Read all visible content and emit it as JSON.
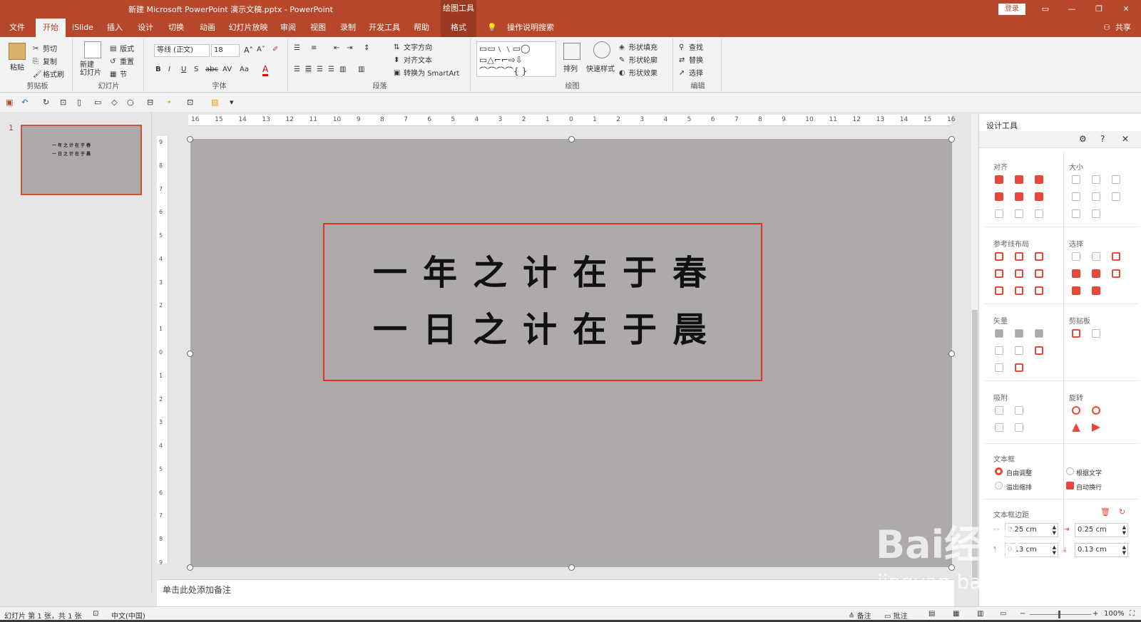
{
  "titlebar": {
    "title": "新建 Microsoft PowerPoint 演示文稿.pptx  -  PowerPoint",
    "contextual": "绘图工具",
    "login": "登录"
  },
  "tabs": [
    "文件",
    "开始",
    "iSlide",
    "插入",
    "设计",
    "切换",
    "动画",
    "幻灯片放映",
    "审阅",
    "视图",
    "录制",
    "开发工具",
    "帮助",
    "格式"
  ],
  "search_hint": "操作说明搜索",
  "share": "共享",
  "ribbon": {
    "clipboard": {
      "label": "剪贴板",
      "paste": "粘贴",
      "cut": "剪切",
      "copy": "复制",
      "painter": "格式刷"
    },
    "slides": {
      "label": "幻灯片",
      "new_slide": "新建\n幻灯片",
      "layout": "版式",
      "reset": "重置",
      "section": "节"
    },
    "font": {
      "label": "字体",
      "font_name": "等线 (正文)",
      "font_size": "18"
    },
    "paragraph": {
      "label": "段落",
      "text_dir": "文字方向",
      "align_text": "对齐文本",
      "smartart": "转换为 SmartArt"
    },
    "drawing": {
      "label": "绘图",
      "arrange": "排列",
      "quick_styles": "快速样式",
      "fill": "形状填充",
      "outline": "形状轮廓",
      "effects": "形状效果"
    },
    "editing": {
      "label": "编辑",
      "find": "查找",
      "replace": "替换",
      "select": "选择"
    }
  },
  "ruler_h": [
    "16",
    "15",
    "14",
    "13",
    "12",
    "11",
    "10",
    "9",
    "8",
    "7",
    "6",
    "5",
    "4",
    "3",
    "2",
    "1",
    "0",
    "1",
    "2",
    "3",
    "4",
    "5",
    "6",
    "7",
    "8",
    "9",
    "10",
    "11",
    "12",
    "13",
    "14",
    "15",
    "16"
  ],
  "ruler_v": [
    "9",
    "8",
    "7",
    "6",
    "5",
    "4",
    "3",
    "2",
    "1",
    "0",
    "1",
    "2",
    "3",
    "4",
    "5",
    "6",
    "7",
    "8",
    "9"
  ],
  "thumbnail": {
    "number": "1",
    "line1": "一年之计在于春",
    "line2": "一日之计在于晨"
  },
  "slide": {
    "line1": "一年之计在于春",
    "line2": "一日之计在于晨"
  },
  "notes_placeholder": "单击此处添加备注",
  "panel": {
    "title": "设计工具",
    "sections": {
      "align": "对齐",
      "size": "大小",
      "guides": "参考线布局",
      "select": "选择",
      "vector": "矢量",
      "clipboard": "剪贴板",
      "snap": "吸附",
      "rotate": "旋转",
      "textbox": "文本框",
      "margins": "文本框边距"
    },
    "textbox_options": {
      "auto_adjust": "自由调整",
      "fit_text": "根据文字",
      "overflow": "溢出缩排",
      "auto_wrap": "自动换行"
    },
    "margins": {
      "left": "0.25 cm",
      "right": "0.25 cm",
      "top": "0.13 cm",
      "bottom": "0.13 cm"
    }
  },
  "status": {
    "slide_info": "幻灯片 第 1 张，共 1 张",
    "lang": "中文(中国)",
    "notes": "备注",
    "comments": "批注",
    "zoom": "100%"
  },
  "watermark": {
    "logo": "Bai经验",
    "url": "jingyan.baidu.com"
  },
  "colors": {
    "brand": "#b7472a",
    "accent_red": "#e8483a",
    "slide_bg": "#adaaa9"
  }
}
